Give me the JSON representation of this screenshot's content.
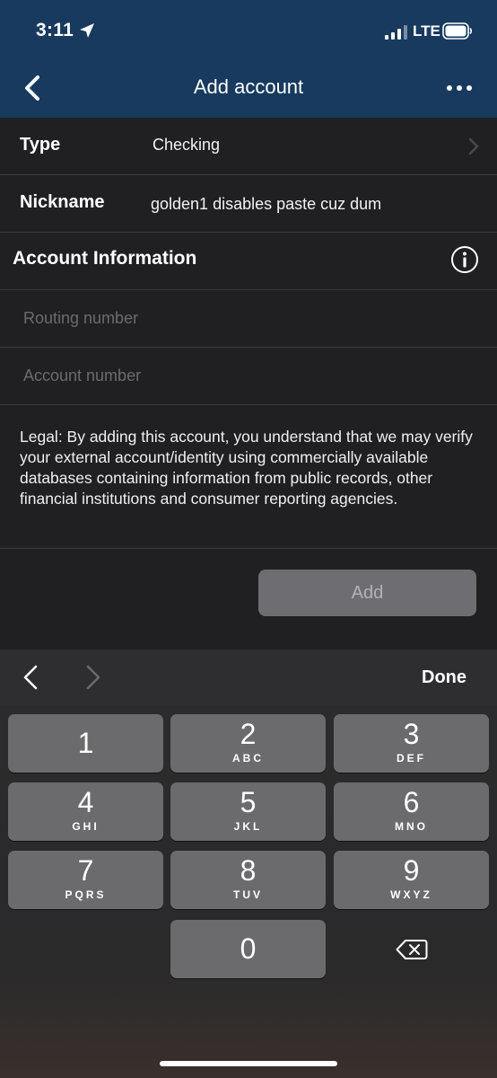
{
  "status_bar": {
    "time": "3:11",
    "network": "LTE"
  },
  "nav": {
    "title": "Add account"
  },
  "form": {
    "type_label": "Type",
    "type_value": "Checking",
    "nickname_label": "Nickname",
    "nickname_value": "golden1 disables paste cuz dum",
    "section_title": "Account Information",
    "routing_placeholder": "Routing number",
    "account_placeholder": "Account number",
    "legal_text": "Legal: By adding this account, you understand that we may verify your external account/identity using commercially available databases containing information from public records, other financial institutions and consumer reporting agencies.",
    "add_label": "Add"
  },
  "keyboard": {
    "done_label": "Done",
    "keys": [
      {
        "digit": "1",
        "letters": ""
      },
      {
        "digit": "2",
        "letters": "ABC"
      },
      {
        "digit": "3",
        "letters": "DEF"
      },
      {
        "digit": "4",
        "letters": "GHI"
      },
      {
        "digit": "5",
        "letters": "JKL"
      },
      {
        "digit": "6",
        "letters": "MNO"
      },
      {
        "digit": "7",
        "letters": "PQRS"
      },
      {
        "digit": "8",
        "letters": "TUV"
      },
      {
        "digit": "9",
        "letters": "WXYZ"
      },
      {
        "digit": "0",
        "letters": ""
      }
    ]
  },
  "colors": {
    "header_bg": "#173a5e",
    "form_bg": "#202022",
    "key_bg": "#6b6b6e",
    "add_button_bg": "#6e6e72"
  }
}
